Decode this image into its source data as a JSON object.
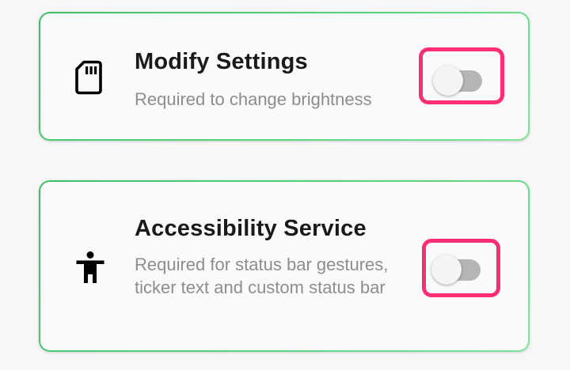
{
  "permissions": [
    {
      "title": "Modify Settings",
      "description": "Required to change brightness",
      "icon": "sd-card-icon",
      "enabled": false
    },
    {
      "title": "Accessibility Service",
      "description": "Required for status bar gestures, ticker text and custom status bar",
      "icon": "accessibility-icon",
      "enabled": false
    }
  ],
  "colors": {
    "highlight": "#ff2d74",
    "card_border": "#3fbf6a",
    "switch_off_track": "#b5b5b5"
  }
}
